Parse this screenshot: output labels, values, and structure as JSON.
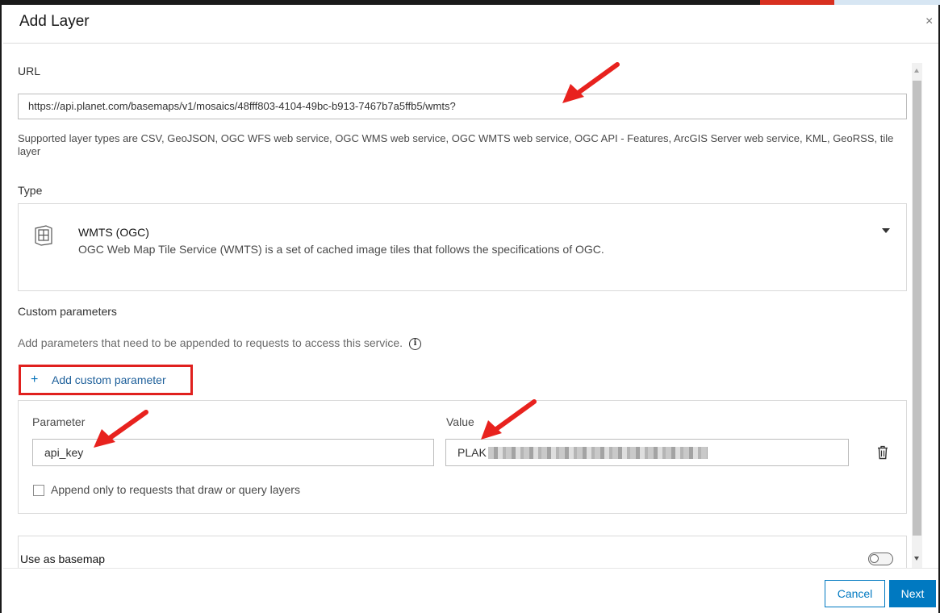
{
  "dialog": {
    "title": "Add Layer"
  },
  "url_section": {
    "label": "URL",
    "value": "https://api.planet.com/basemaps/v1/mosaics/48fff803-4104-49bc-b913-7467b7a5ffb5/wmts?",
    "help_text": "Supported layer types are CSV, GeoJSON, OGC WFS web service, OGC WMS web service, OGC WMTS web service, OGC API - Features, ArcGIS Server web service, KML, GeoRSS, tile layer"
  },
  "type_section": {
    "label": "Type",
    "selected_name": "WMTS (OGC)",
    "selected_description": "OGC Web Map Tile Service (WMTS) is a set of cached image tiles that follows the specifications of OGC."
  },
  "custom_parameters": {
    "heading": "Custom parameters",
    "description": "Add parameters that need to be appended to requests to access this service.",
    "add_button_label": "Add custom parameter",
    "parameter_label": "Parameter",
    "parameter_value": "api_key",
    "value_label": "Value",
    "value_prefix": "PLAK",
    "checkbox_label": "Append only to requests that draw or query layers"
  },
  "basemap": {
    "label": "Use as basemap"
  },
  "footer": {
    "cancel_label": "Cancel",
    "next_label": "Next"
  },
  "colors": {
    "accent": "#0079c1",
    "highlight": "#e0201e",
    "arrow": "#e8221e"
  }
}
